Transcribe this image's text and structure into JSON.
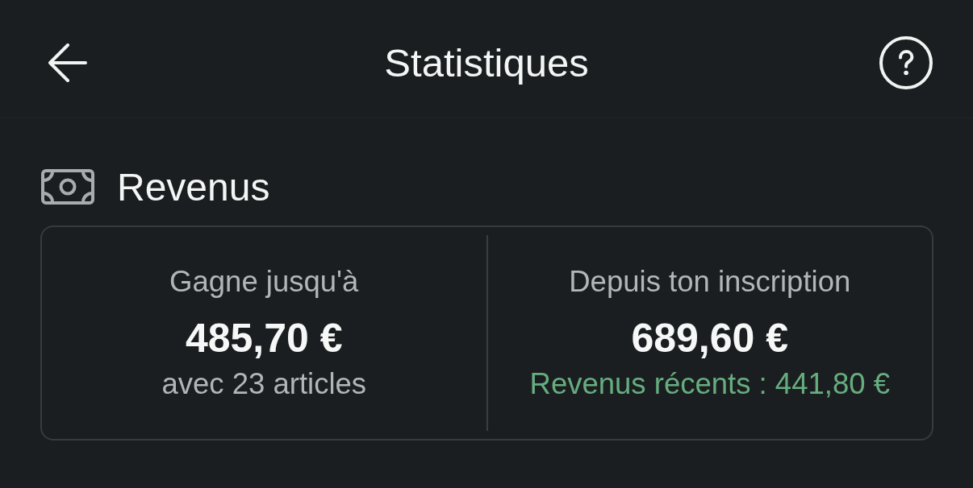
{
  "header": {
    "title": "Statistiques"
  },
  "section": {
    "title": "Revenus"
  },
  "stats": [
    {
      "label": "Gagne jusqu'à",
      "amount": "485,70 €",
      "note": "avec 23 articles",
      "kind": "plain"
    },
    {
      "label": "Depuis ton inscription",
      "amount": "689,60 €",
      "note": "Revenus récents : 441,80 €",
      "kind": "gain"
    }
  ]
}
